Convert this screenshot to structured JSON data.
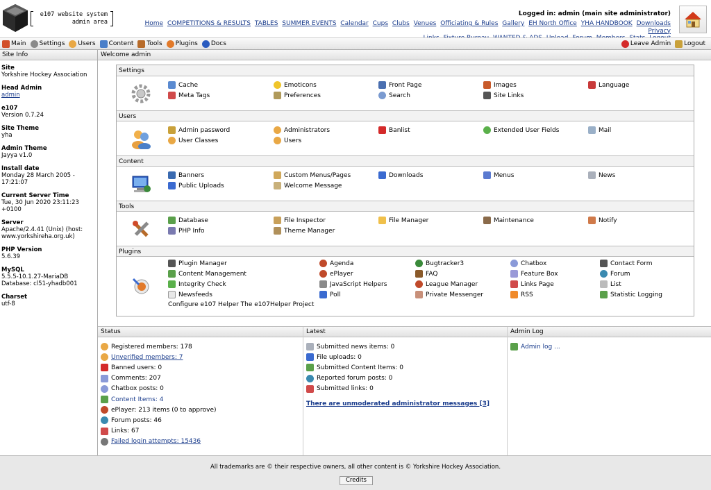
{
  "header": {
    "logo_line1": "e107 website system",
    "logo_line2": "admin area",
    "logged_in": "Logged in: admin (main site administrator)",
    "top_links": [
      "Home",
      "COMPETITIONS & RESULTS",
      "TABLES",
      "SUMMER EVENTS",
      "Calendar",
      "Cups",
      "Clubs",
      "Venues",
      "Officiating & Rules",
      "Gallery",
      "EH North Office",
      "YHA HANDBOOK",
      "Downloads",
      "Privacy",
      "Links",
      "Fixture Bureau",
      "WANTED & ADS",
      "Upload",
      "Forum",
      "Members",
      "Stats",
      "Logout"
    ]
  },
  "toolbar": {
    "main": "Main",
    "settings": "Settings",
    "users": "Users",
    "content": "Content",
    "tools": "Tools",
    "plugins": "Plugins",
    "docs": "Docs",
    "leave_admin": "Leave Admin",
    "logout": "Logout"
  },
  "sidebar": {
    "title": "Site Info",
    "site_label": "Site",
    "site_value": "Yorkshire Hockey Association",
    "head_admin_label": "Head Admin",
    "head_admin_value": "admin",
    "e107_label": "e107",
    "e107_value": "Version 0.7.24",
    "site_theme_label": "Site Theme",
    "site_theme_value": "yha",
    "admin_theme_label": "Admin Theme",
    "admin_theme_value": "Jayya v1.0",
    "install_label": "Install date",
    "install_value": "Monday 28 March 2005 - 17:21:07",
    "server_time_label": "Current Server Time",
    "server_time_value": "Tue, 30 Jun 2020 23:11:23 +0100",
    "server_label": "Server",
    "server_value": "Apache/2.4.41 (Unix) (host: www.yorkshireha.org.uk)",
    "php_label": "PHP Version",
    "php_value": "5.6.39",
    "mysql_label": "MySQL",
    "mysql_value": "5.5.5-10.1.27-MariaDB Database: cl51-yhadb001",
    "charset_label": "Charset",
    "charset_value": "utf-8"
  },
  "main": {
    "title": "Welcome admin",
    "sections": {
      "settings": {
        "title": "Settings",
        "items": [
          "Cache",
          "Emoticons",
          "Front Page",
          "Images",
          "Language",
          "Meta Tags",
          "Preferences",
          "Search",
          "Site Links"
        ]
      },
      "users": {
        "title": "Users",
        "items": [
          "Admin password",
          "Administrators",
          "Banlist",
          "Extended User Fields",
          "Mail",
          "User Classes",
          "Users"
        ]
      },
      "content": {
        "title": "Content",
        "items": [
          "Banners",
          "Custom Menus/Pages",
          "Downloads",
          "Menus",
          "News",
          "Public Uploads",
          "Welcome Message"
        ]
      },
      "tools": {
        "title": "Tools",
        "items": [
          "Database",
          "File Inspector",
          "File Manager",
          "Maintenance",
          "Notify",
          "PHP Info",
          "Theme Manager"
        ]
      },
      "plugins": {
        "title": "Plugins",
        "items": [
          "Plugin Manager",
          "Agenda",
          "Bugtracker3",
          "Chatbox",
          "Contact Form",
          "Content Management",
          "ePlayer",
          "FAQ",
          "Feature Box",
          "Forum",
          "Integrity Check",
          "JavaScript Helpers",
          "League Manager",
          "Links Page",
          "List",
          "Newsfeeds",
          "Poll",
          "Private Messenger",
          "RSS",
          "Statistic Logging"
        ],
        "note": "Configure e107 Helper The e107Helper Project"
      }
    }
  },
  "status": {
    "title": "Status",
    "rows": [
      "Registered members: 178",
      "Unverified members: 7",
      "Banned users: 0",
      "Comments: 207",
      "Chatbox posts: 0",
      "Content Items: 4",
      "ePlayer: 213 items (0 to approve)",
      "Forum posts: 46",
      "Links: 67",
      "Failed login attempts: 15436"
    ]
  },
  "latest": {
    "title": "Latest",
    "rows": [
      "Submitted news items: 0",
      "File uploads: 0",
      "Submitted Content Items: 0",
      "Reported forum posts: 0",
      "Submitted links: 0"
    ],
    "unmoderated": "There are unmoderated administrator messages [3]"
  },
  "adminlog": {
    "title": "Admin Log",
    "link": "Admin log ..."
  },
  "footer": {
    "text": "All trademarks are © their respective owners, all other content is © Yorkshire Hockey Association.",
    "credits": "Credits"
  }
}
